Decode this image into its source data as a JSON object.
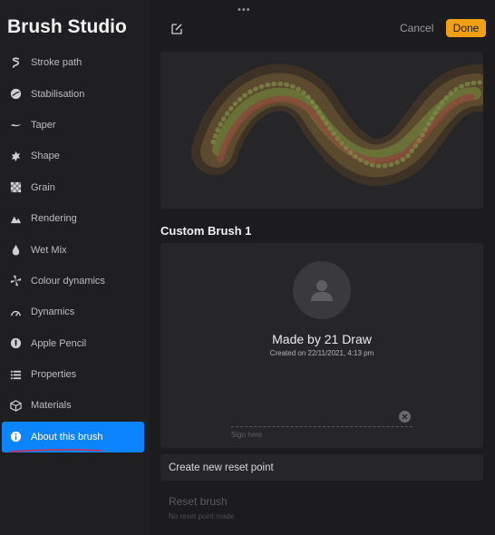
{
  "app_title": "Brush Studio",
  "sidebar": {
    "items": [
      {
        "label": "Stroke path",
        "icon": "stroke-path-icon"
      },
      {
        "label": "Stabilisation",
        "icon": "stabilisation-icon"
      },
      {
        "label": "Taper",
        "icon": "taper-icon"
      },
      {
        "label": "Shape",
        "icon": "shape-icon"
      },
      {
        "label": "Grain",
        "icon": "grain-icon"
      },
      {
        "label": "Rendering",
        "icon": "rendering-icon"
      },
      {
        "label": "Wet Mix",
        "icon": "wet-mix-icon"
      },
      {
        "label": "Colour dynamics",
        "icon": "colour-dynamics-icon"
      },
      {
        "label": "Dynamics",
        "icon": "dynamics-icon"
      },
      {
        "label": "Apple Pencil",
        "icon": "apple-pencil-icon"
      },
      {
        "label": "Properties",
        "icon": "properties-icon"
      },
      {
        "label": "Materials",
        "icon": "materials-icon"
      },
      {
        "label": "About this brush",
        "icon": "info-icon",
        "active": true
      }
    ]
  },
  "toolbar": {
    "grabber": "•••",
    "cancel_label": "Cancel",
    "done_label": "Done"
  },
  "brush": {
    "name": "Custom Brush 1",
    "made_by": "Made by 21 Draw",
    "created_on": "Created on 22/11/2021, 4:13 pm",
    "sign_here": "Sign here"
  },
  "reset": {
    "create_label": "Create new reset point",
    "reset_label": "Reset brush",
    "reset_sub": "No reset point made"
  },
  "colors": {
    "accent": "#0a84ff",
    "done": "#f0a012",
    "background": "#1c1c1e",
    "card": "#262628"
  }
}
